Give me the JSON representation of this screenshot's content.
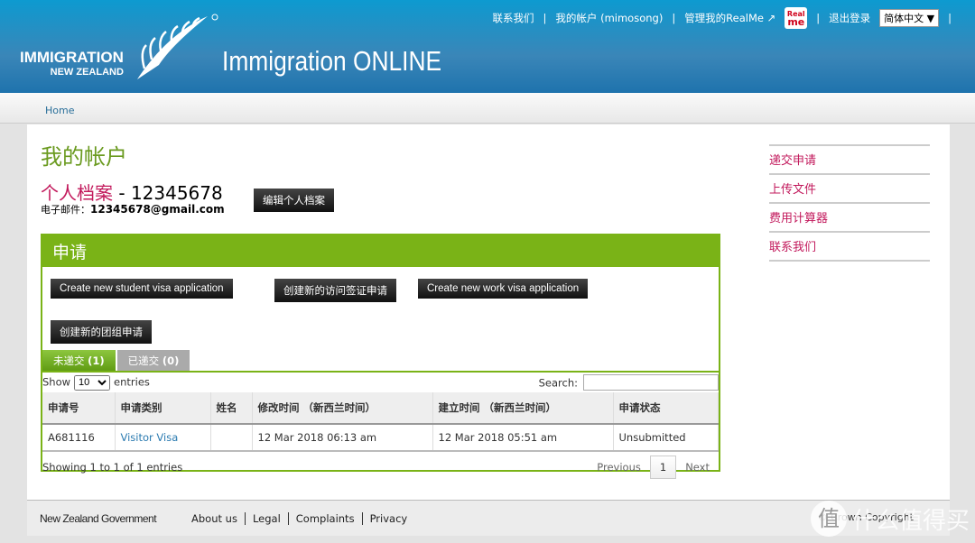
{
  "header": {
    "logo_line1": "IMMIGRATION",
    "logo_line2": "NEW ZEALAND",
    "app_title": "Immigration ONLINE",
    "links": {
      "contact": "联系我们",
      "account": "我的帐户 (mimosong)",
      "realme": "管理我的RealMe",
      "realme_badge_top": "Real",
      "realme_badge_bottom": "me",
      "logout": "退出登录",
      "separator": "|"
    },
    "language": "简体中文"
  },
  "breadcrumb": {
    "home": "Home"
  },
  "main": {
    "title": "我的帐户",
    "profile_label": "个人档案",
    "profile_dash": " - ",
    "profile_number": "12345678",
    "email_label": "电子邮件：",
    "email": "12345678@gmail.com",
    "edit_profile": "编辑个人档案"
  },
  "applications": {
    "heading": "申请",
    "buttons": [
      "Create new student visa application",
      "创建新的访问签证申请",
      "Create new work visa application",
      "创建新的团组申请"
    ],
    "tabs": [
      {
        "label": "未递交",
        "count": "(1)",
        "active": true
      },
      {
        "label": "已递交",
        "count": "(0)",
        "active": false
      }
    ],
    "show_label": "Show",
    "page_size": "10",
    "entries_label": "entries",
    "search_label": "Search:",
    "search_value": "",
    "columns": [
      "申请号",
      "申请类别",
      "姓名",
      "修改时间 （新西兰时间）",
      "建立时间 （新西兰时间）",
      "申请状态"
    ],
    "rows": [
      {
        "id": "A681116",
        "type": "Visitor Visa",
        "name": "",
        "modified": "12 Mar 2018 06:13 am",
        "created": "12 Mar 2018 05:51 am",
        "status": "Unsubmitted"
      }
    ],
    "summary": "Showing 1 to 1 of 1 entries",
    "previous": "Previous",
    "page": "1",
    "next": "Next"
  },
  "sidebar": {
    "items": [
      "递交申请",
      "上传文件",
      "费用计算器",
      "联系我们"
    ]
  },
  "footer": {
    "govt": "New Zealand Government",
    "links": [
      "About us",
      "Legal",
      "Complaints",
      "Privacy"
    ],
    "copyright": "© Crown Copyright"
  },
  "watermark": {
    "icon": "值",
    "text": "什么值得买"
  },
  "colors": {
    "header_blue": "#1f73ad",
    "accent_green": "#7ab317",
    "link_pink": "#c2185b"
  }
}
